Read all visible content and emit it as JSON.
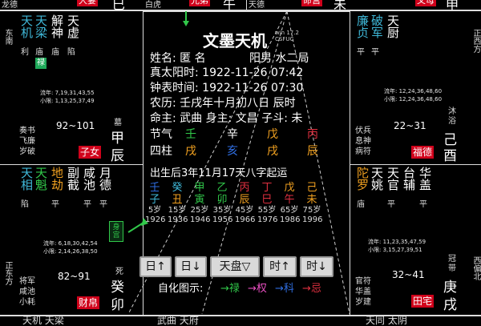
{
  "colors": {
    "red": "#d0021b",
    "green": "#31c84a",
    "orange": "#f0a020",
    "cyan": "#3fb8d8",
    "blue": "#2f6de0"
  },
  "top_strip": {
    "left_gods": "龙德",
    "left_tag": "大妻",
    "left_branch": "巳",
    "mid_gods": "白虎",
    "mid_tag": "兄弟",
    "mid_branch": "午",
    "right_gods": "天德",
    "right_tag": "命宫",
    "right_branch": "未",
    "far_tag": "父母",
    "far_branch": "申"
  },
  "directions": {
    "left_top": "东南",
    "left_bottom": "正东方",
    "right_top": "正西方",
    "right_bottom": "西偏北"
  },
  "palace_chen": {
    "stars": [
      "天机",
      "天梁",
      "解神",
      "天虚"
    ],
    "brightness": [
      "利",
      "庙",
      "庙",
      "陷"
    ],
    "lu_tag": "禄",
    "liunian": "流年: 7,19,31,43,55",
    "xiaoxian": "小限: 1,13,25,37,49",
    "gods": [
      "奏书",
      "飞廉",
      "岁破"
    ],
    "age": "92~101",
    "changsheng": "墓",
    "stem": "甲",
    "branch": "辰",
    "palace": "子女"
  },
  "palace_mao": {
    "stars": [
      "天相",
      "天魁",
      "地劫",
      "副截",
      "咸池",
      "月德"
    ],
    "brightness": [
      "陷",
      "",
      "平",
      "",
      "平",
      "平"
    ],
    "liunian": "流年: 6,18,30,42,54",
    "xiaoxian": "小限: 2,14,26,38,50",
    "gods": [
      "将军",
      "咸池",
      "小耗"
    ],
    "age": "82~91",
    "changsheng": "死",
    "stem": "癸",
    "branch": "卯",
    "palace": "财帛",
    "shen_tag": "身宫"
  },
  "palace_you": {
    "stars": [
      "廉贞",
      "破军",
      "天厨"
    ],
    "brightness": [
      "平",
      "平",
      ""
    ],
    "liunian": "流年: 12,24,36,48,60",
    "xiaoxian": "小限: 12,24,36,48,60",
    "gods": [
      "伏兵",
      "息神",
      "病符"
    ],
    "age": "22~31",
    "changsheng": "沐浴",
    "stem": "己",
    "branch": "酉",
    "palace": "福德"
  },
  "palace_xu": {
    "stars": [
      "陀罗",
      "天姚",
      "天官",
      "台辅",
      "华盖"
    ],
    "brightness": [
      "庙",
      "",
      "平",
      "",
      "平"
    ],
    "liunian": "流年: 11,23,35,47,59",
    "xiaoxian": "小限: 3,15,27,39,51",
    "gods": [
      "官符",
      "华盖",
      "岁建"
    ],
    "age": "32~41",
    "changsheng": "冠带",
    "stem": "庚",
    "branch": "戌",
    "palace": "田宅"
  },
  "center": {
    "title": "文墨天机",
    "subtitle": "win 17.2 CSFUC",
    "name_line": "姓名: 匿 名",
    "gender_line": "阳男 水二局",
    "solar_time": "真太阳时: 1922-11-26 07:42",
    "clock_time": "钟表时间: 1922-11-26 07:30",
    "lunar": "农历: 壬戌年十月初八日 辰时",
    "ming_zhu": "命主: 武曲 身主: 文昌 子斗: 未",
    "jieqi_label": "节气",
    "sizhu_label": "四柱",
    "jieqi": [
      "壬",
      "辛",
      "戊",
      "丙"
    ],
    "sizhu": [
      "戌",
      "亥",
      "戌",
      "辰"
    ],
    "qiyun": "出生后3年11月17天八字起运",
    "dayun": [
      {
        "stem": "壬",
        "branch": "子",
        "age": "5岁",
        "year": "1926"
      },
      {
        "stem": "癸",
        "branch": "丑",
        "age": "15岁",
        "year": "1936"
      },
      {
        "stem": "甲",
        "branch": "寅",
        "age": "25岁",
        "year": "1946"
      },
      {
        "stem": "乙",
        "branch": "卯",
        "age": "35岁",
        "year": "1956"
      },
      {
        "stem": "丙",
        "branch": "辰",
        "age": "45岁",
        "year": "1966"
      },
      {
        "stem": "丁",
        "branch": "巳",
        "age": "55岁",
        "year": "1976"
      },
      {
        "stem": "戊",
        "branch": "午",
        "age": "65岁",
        "year": "1986"
      },
      {
        "stem": "己",
        "branch": "未",
        "age": "75岁",
        "year": "1996"
      }
    ],
    "buttons": [
      "日↑",
      "日↓",
      "天盘▽",
      "时↑",
      "时↓"
    ],
    "zihua_label": "自化图示:",
    "zihua": [
      "→禄",
      "→权",
      "→科",
      "→忌"
    ]
  },
  "bottom_strip": {
    "left": "天机 天梁",
    "mid": "武曲 天府",
    "right": "天同 太阴"
  }
}
